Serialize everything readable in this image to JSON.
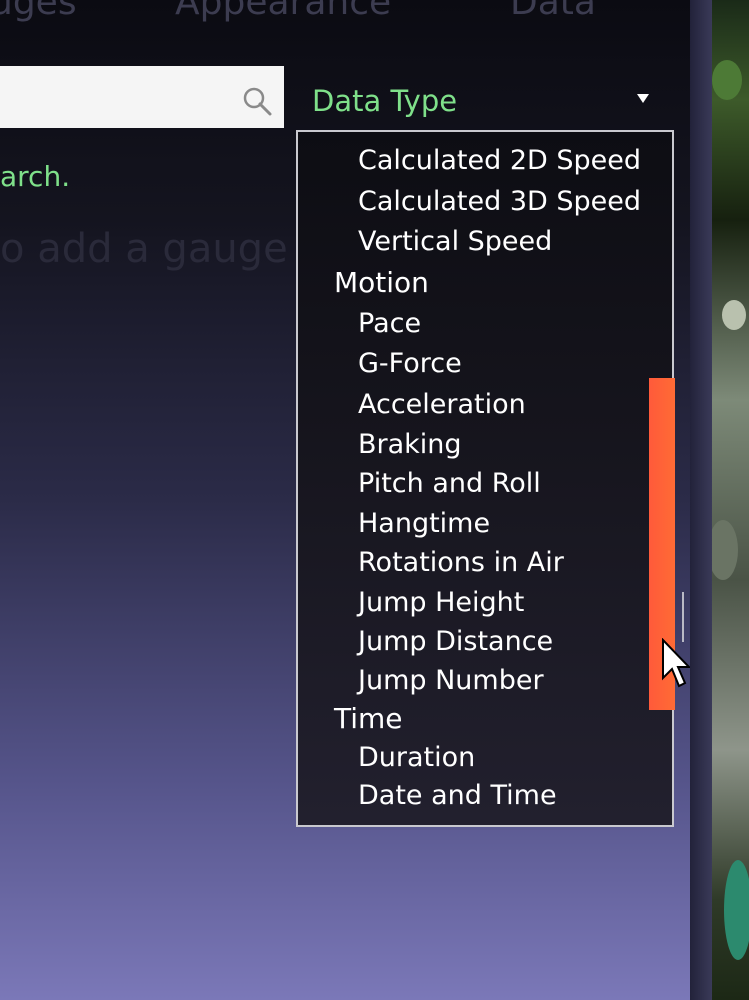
{
  "tabs": [
    "uges",
    "Appearance",
    "Data"
  ],
  "search": {
    "hint_text": "arch.",
    "empty_message": "o add a gauge"
  },
  "data_type": {
    "label": "Data Type",
    "options": [
      {
        "label": "Calculated 2D Speed",
        "group": false
      },
      {
        "label": "Calculated 3D Speed",
        "group": false
      },
      {
        "label": "Vertical Speed",
        "group": false
      },
      {
        "label": "Motion",
        "group": true
      },
      {
        "label": "Pace",
        "group": false
      },
      {
        "label": "G-Force",
        "group": false
      },
      {
        "label": "Acceleration",
        "group": false
      },
      {
        "label": "Braking",
        "group": false
      },
      {
        "label": "Pitch and Roll",
        "group": false
      },
      {
        "label": "Hangtime",
        "group": false
      },
      {
        "label": "Rotations in Air",
        "group": false
      },
      {
        "label": "Jump Height",
        "group": false
      },
      {
        "label": "Jump Distance",
        "group": false
      },
      {
        "label": "Jump Number",
        "group": false
      },
      {
        "label": "Time",
        "group": true
      },
      {
        "label": "Duration",
        "group": false
      },
      {
        "label": "Date and Time",
        "group": false
      }
    ]
  },
  "colors": {
    "accent_green": "#7fe08a",
    "scrollbar_thumb": "#ff6b35"
  },
  "icons": [
    "search-icon",
    "chevron-down-icon",
    "mouse-cursor-icon"
  ]
}
